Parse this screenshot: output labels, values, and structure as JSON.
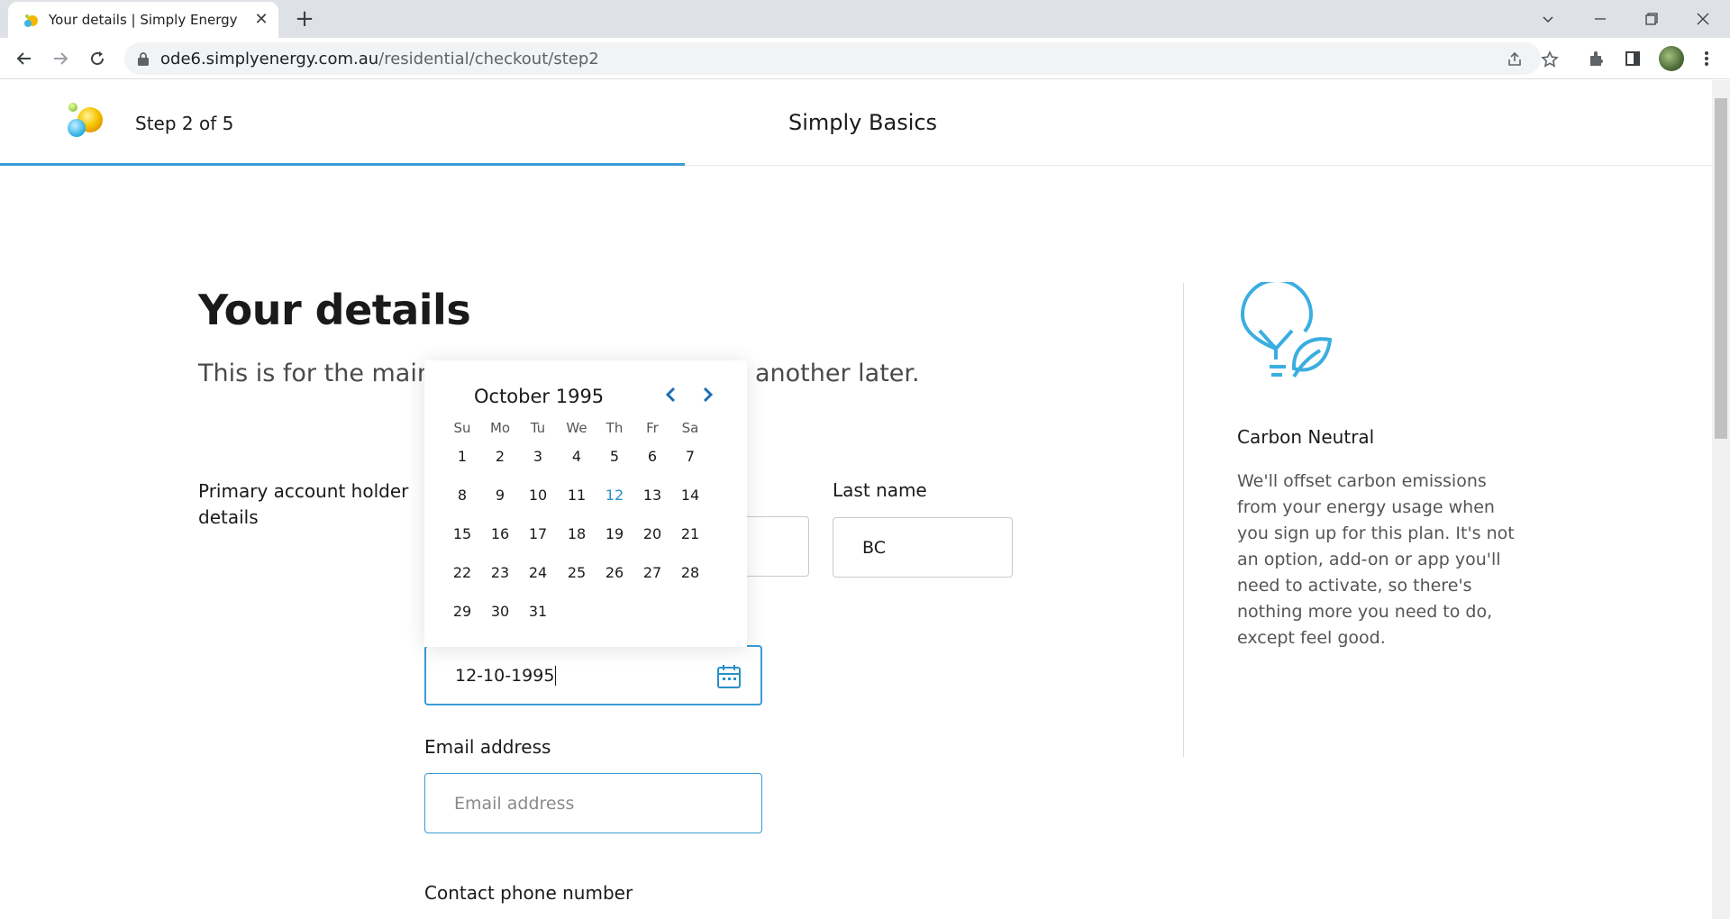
{
  "browser": {
    "tab_title": "Your details | Simply Energy",
    "url_host": "ode6.simplyenergy.com.au",
    "url_path": "/residential/checkout/step2"
  },
  "header": {
    "step": "Step 2 of 5",
    "plan": "Simply Basics",
    "progress_fraction": 0.4
  },
  "page": {
    "title": "Your details",
    "subtitle_left": "This is for the main a",
    "subtitle_right": "another later."
  },
  "form": {
    "section_label": "Primary account holder details",
    "last_name_label": "Last name",
    "last_name_value": "BC",
    "dob_value": "12-10-1995",
    "email_label": "Email address",
    "email_placeholder": "Email address",
    "phone_label": "Contact phone number"
  },
  "datepicker": {
    "month_label": "October 1995",
    "weekdays": [
      "Su",
      "Mo",
      "Tu",
      "We",
      "Th",
      "Fr",
      "Sa"
    ],
    "selected_day": 12,
    "weeks": [
      [
        "1",
        "2",
        "3",
        "4",
        "5",
        "6",
        "7"
      ],
      [
        "8",
        "9",
        "10",
        "11",
        "12",
        "13",
        "14"
      ],
      [
        "15",
        "16",
        "17",
        "18",
        "19",
        "20",
        "21"
      ],
      [
        "22",
        "23",
        "24",
        "25",
        "26",
        "27",
        "28"
      ],
      [
        "29",
        "30",
        "31"
      ]
    ]
  },
  "side_panel": {
    "title": "Carbon Neutral",
    "body": "We'll offset carbon emissions from your energy usage when you sign up for this plan. It's not an option, add-on or app you'll need to activate, so there's nothing more you need to do, except feel good."
  },
  "colors": {
    "accent": "#3a9bd5",
    "text": "#1a1a1a",
    "muted": "#555555"
  }
}
